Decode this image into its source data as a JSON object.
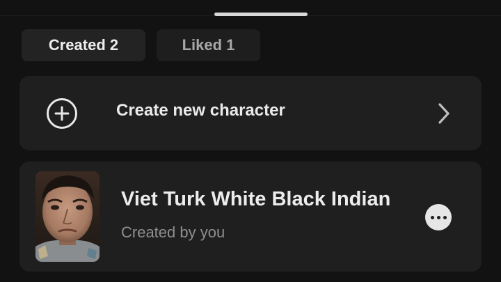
{
  "tabs": [
    {
      "label": "Created 2",
      "active": true
    },
    {
      "label": "Liked 1",
      "active": false
    }
  ],
  "create_card": {
    "label": "Create new character",
    "leading_icon": "plus-circle-icon",
    "trailing_icon": "chevron-right-icon"
  },
  "character": {
    "name": "Viet Turk White Black Indian",
    "subtitle": "Created by you",
    "menu_icon": "more-horizontal-icon"
  },
  "colors": {
    "background": "#121212",
    "card": "#1e1f1e",
    "tab_active": "#232323",
    "tab_inactive": "#1e1e1e",
    "text_primary": "#ececec",
    "text_secondary": "#8f8f8f"
  }
}
